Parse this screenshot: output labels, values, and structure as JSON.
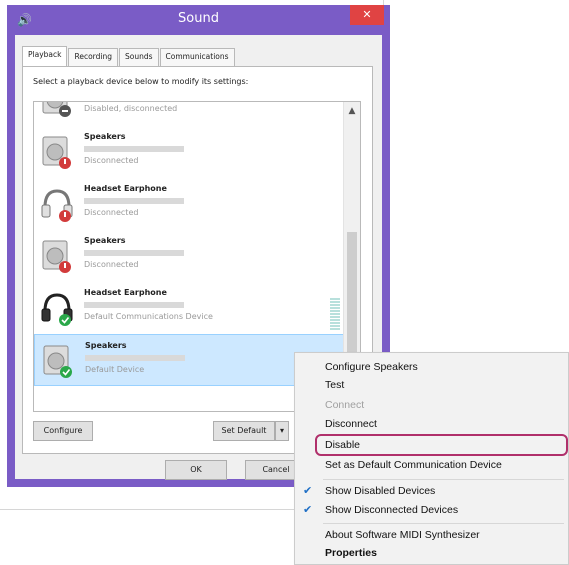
{
  "window": {
    "title": "Sound",
    "close_label": "✕"
  },
  "tabs": [
    {
      "label": "Playback"
    },
    {
      "label": "Recording"
    },
    {
      "label": "Sounds"
    },
    {
      "label": "Communications"
    }
  ],
  "instruction": "Select a playback device below to modify its settings:",
  "devices": [
    {
      "name": "",
      "status": "Disabled, disconnected"
    },
    {
      "name": "Speakers",
      "status": "Disconnected"
    },
    {
      "name": "Headset Earphone",
      "status": "Disconnected"
    },
    {
      "name": "Speakers",
      "status": "Disconnected"
    },
    {
      "name": "Headset Earphone",
      "status": "Default Communications Device"
    },
    {
      "name": "Speakers",
      "status": "Default Device"
    }
  ],
  "buttons": {
    "configure": "Configure",
    "set_default": "Set Default",
    "dropdown": "▾",
    "ok": "OK",
    "cancel": "Cancel"
  },
  "context_menu": {
    "items": [
      "Configure Speakers",
      "Test",
      "Connect",
      "Disconnect",
      "Disable",
      "Set as Default Communication Device",
      "Show Disabled Devices",
      "Show Disconnected Devices",
      "About Software MIDI Synthesizer",
      "Properties"
    ],
    "check_glyph": "✔"
  },
  "colors": {
    "title_bar": "#7a5cc6",
    "close_button": "#e04343",
    "selected_row": "#cde8ff",
    "highlight_ring": "#b0306b",
    "status_ok": "#2aa84a",
    "status_error": "#d23b3b"
  }
}
